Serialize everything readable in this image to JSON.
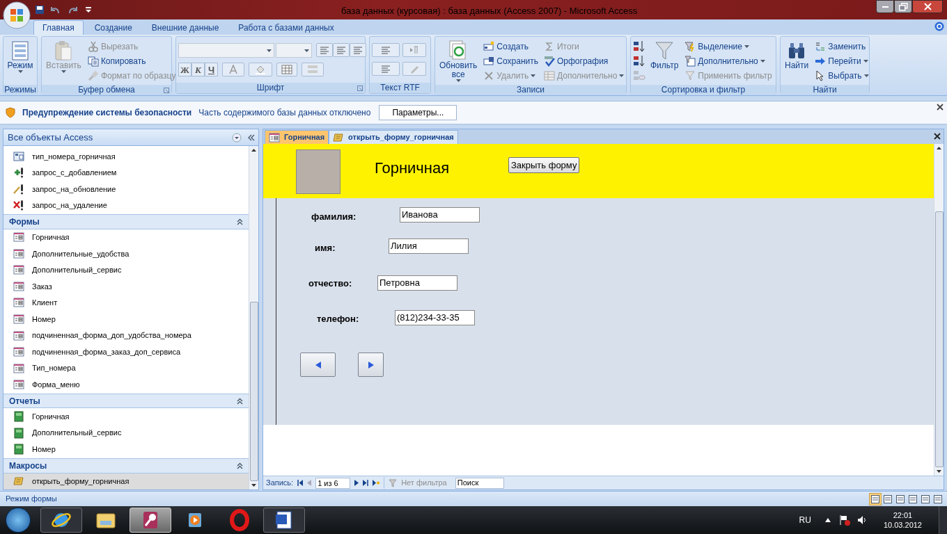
{
  "window": {
    "title": "база данных (курсовая) : база данных (Access 2007)  -  Microsoft Access"
  },
  "ribbon": {
    "tabs": [
      {
        "label": "Главная",
        "selected": true
      },
      {
        "label": "Создание",
        "selected": false
      },
      {
        "label": "Внешние данные",
        "selected": false
      },
      {
        "label": "Работа с базами данных",
        "selected": false
      }
    ],
    "groups": [
      {
        "kind": "views",
        "label": "Режимы",
        "large": {
          "label": "Режим",
          "dropdown": true,
          "disabled": false
        }
      },
      {
        "kind": "clipboard",
        "label": "Буфер обмена",
        "launcher": true,
        "large": {
          "label": "Вставить",
          "dropdown": true,
          "disabled": true
        },
        "items": [
          {
            "label": "Вырезать",
            "disabled": true,
            "dropdown": false
          },
          {
            "label": "Копировать",
            "disabled": false,
            "dropdown": false
          },
          {
            "label": "Формат по образцу",
            "disabled": true,
            "dropdown": false
          }
        ]
      },
      {
        "kind": "font",
        "label": "Шрифт",
        "launcher": true,
        "style_buttons": [
          "Ж",
          "К",
          "Ч"
        ]
      },
      {
        "kind": "rtf",
        "label": "Текст RTF",
        "launcher": false
      },
      {
        "kind": "records",
        "label": "Записи",
        "launcher": false,
        "large": {
          "label": "Обновить все",
          "dropdown": true,
          "disabled": false
        },
        "items": [
          {
            "label": "Создать",
            "disabled": false,
            "dropdown": false
          },
          {
            "label": "Сохранить",
            "disabled": false,
            "dropdown": false
          },
          {
            "label": "Удалить",
            "disabled": true,
            "dropdown": true
          },
          {
            "label": "Итоги",
            "disabled": true,
            "dropdown": false
          },
          {
            "label": "Орфография",
            "disabled": false,
            "dropdown": false
          },
          {
            "label": "Дополнительно",
            "disabled": true,
            "dropdown": true
          }
        ]
      },
      {
        "kind": "sort",
        "label": "Сортировка и фильтр",
        "launcher": false,
        "large": {
          "label": "Фильтр",
          "dropdown": false,
          "disabled": false
        },
        "items": [
          {
            "label": "Выделение",
            "disabled": false,
            "dropdown": true
          },
          {
            "label": "Дополнительно",
            "disabled": false,
            "dropdown": true
          },
          {
            "label": "Применить фильтр",
            "disabled": true,
            "dropdown": false
          }
        ]
      },
      {
        "kind": "find",
        "label": "Найти",
        "launcher": false,
        "large": {
          "label": "Найти",
          "dropdown": false,
          "disabled": false
        },
        "items": [
          {
            "label": "Заменить",
            "disabled": false,
            "dropdown": false
          },
          {
            "label": "Перейти",
            "disabled": false,
            "dropdown": true
          },
          {
            "label": "Выбрать",
            "disabled": false,
            "dropdown": true
          }
        ]
      }
    ]
  },
  "security_bar": {
    "title": "Предупреждение системы безопасности",
    "message": "Часть содержимого базы данных отключено",
    "button": "Параметры..."
  },
  "navigation_pane": {
    "title": "Все объекты Access",
    "groups": [
      {
        "items": [
          {
            "label": "тип_номера_горничная",
            "kind": "select_query",
            "selected": false
          },
          {
            "label": "запрос_с_добавлением",
            "kind": "append_query",
            "selected": false
          },
          {
            "label": "запрос_на_обновление",
            "kind": "update_query",
            "selected": false
          },
          {
            "label": "запрос_на_удаление",
            "kind": "delete_query",
            "selected": false
          }
        ]
      },
      {
        "label": "Формы",
        "items": [
          {
            "label": "Горничная",
            "kind": "form",
            "selected": false
          },
          {
            "label": "Дополнительные_удобства",
            "kind": "form",
            "selected": false
          },
          {
            "label": "Дополнительный_сервис",
            "kind": "form",
            "selected": false
          },
          {
            "label": "Заказ",
            "kind": "form",
            "selected": false
          },
          {
            "label": "Клиент",
            "kind": "form",
            "selected": false
          },
          {
            "label": "Номер",
            "kind": "form",
            "selected": false
          },
          {
            "label": "подчиненная_форма_доп_удобства_номера",
            "kind": "form",
            "selected": false
          },
          {
            "label": "подчиненная_форма_заказ_доп_сервиса",
            "kind": "form",
            "selected": false
          },
          {
            "label": "Тип_номера",
            "kind": "form",
            "selected": false
          },
          {
            "label": "Форма_меню",
            "kind": "form",
            "selected": false
          }
        ]
      },
      {
        "label": "Отчеты",
        "items": [
          {
            "label": "Горничная",
            "kind": "report",
            "selected": false
          },
          {
            "label": "Дополнительный_сервис",
            "kind": "report",
            "selected": false
          },
          {
            "label": "Номер",
            "kind": "report",
            "selected": false
          }
        ]
      },
      {
        "label": "Макросы",
        "items": [
          {
            "label": "открыть_форму_горничная",
            "kind": "macro",
            "selected": true
          }
        ]
      }
    ]
  },
  "document_tabs": [
    {
      "label": "Горничная",
      "kind": "form",
      "selected": true
    },
    {
      "label": "открыть_форму_горничная",
      "kind": "macro",
      "selected": false
    }
  ],
  "form": {
    "title": "Горничная",
    "close_button": "Закрыть форму",
    "fields": [
      {
        "label": "фамилия:",
        "value": "Иванова"
      },
      {
        "label": "имя:",
        "value": "Лилия"
      },
      {
        "label": "отчество:",
        "value": "Петровна"
      },
      {
        "label": "телефон:",
        "value": "(812)234-33-35"
      }
    ]
  },
  "record_navigator": {
    "label": "Запись:",
    "position": "1 из 6",
    "filter": "Нет фильтра",
    "search_placeholder": "Поиск"
  },
  "status_bar": {
    "text": "Режим формы",
    "views": [
      {
        "selected": true
      },
      {
        "selected": false
      },
      {
        "selected": false
      },
      {
        "selected": false
      },
      {
        "selected": false
      },
      {
        "selected": false
      }
    ]
  },
  "taskbar": {
    "apps": [
      {
        "running": true,
        "selected": false
      },
      {
        "running": false,
        "selected": false
      },
      {
        "running": true,
        "selected": true
      },
      {
        "running": false,
        "selected": false
      },
      {
        "running": false,
        "selected": false
      },
      {
        "running": true,
        "selected": false
      }
    ],
    "language": "RU",
    "time": "22:01",
    "date": "10.03.2012"
  }
}
